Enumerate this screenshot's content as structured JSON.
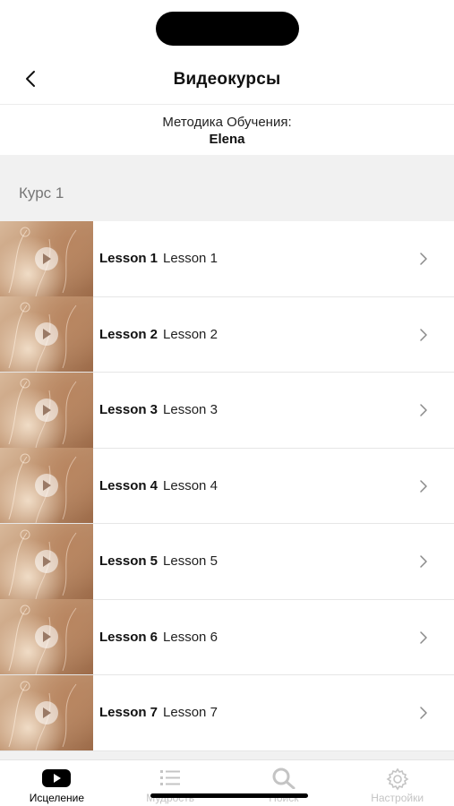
{
  "header": {
    "title": "Видеокурсы"
  },
  "subheader": {
    "line1": "Методика Обучения:",
    "line2": "Elena"
  },
  "section": {
    "title": "Курс 1"
  },
  "lessons": [
    {
      "bold": "Lesson 1",
      "label": "Lesson 1"
    },
    {
      "bold": "Lesson 2",
      "label": "Lesson 2"
    },
    {
      "bold": "Lesson 3",
      "label": "Lesson 3"
    },
    {
      "bold": "Lesson 4",
      "label": "Lesson 4"
    },
    {
      "bold": "Lesson 5",
      "label": "Lesson 5"
    },
    {
      "bold": "Lesson 6",
      "label": "Lesson 6"
    },
    {
      "bold": "Lesson 7",
      "label": "Lesson 7"
    }
  ],
  "tabbar": {
    "tabs": [
      {
        "label": "Исцеление",
        "icon": "play-rect-icon",
        "active": true
      },
      {
        "label": "Мудрость",
        "icon": "list-icon",
        "active": false
      },
      {
        "label": "Поиск",
        "icon": "search-icon",
        "active": false
      },
      {
        "label": "Настройки",
        "icon": "gear-icon",
        "active": false
      }
    ]
  },
  "colors": {
    "accent": "#000000",
    "inactive_tab": "#c4c4c4",
    "section_background": "#f1f1f1"
  }
}
